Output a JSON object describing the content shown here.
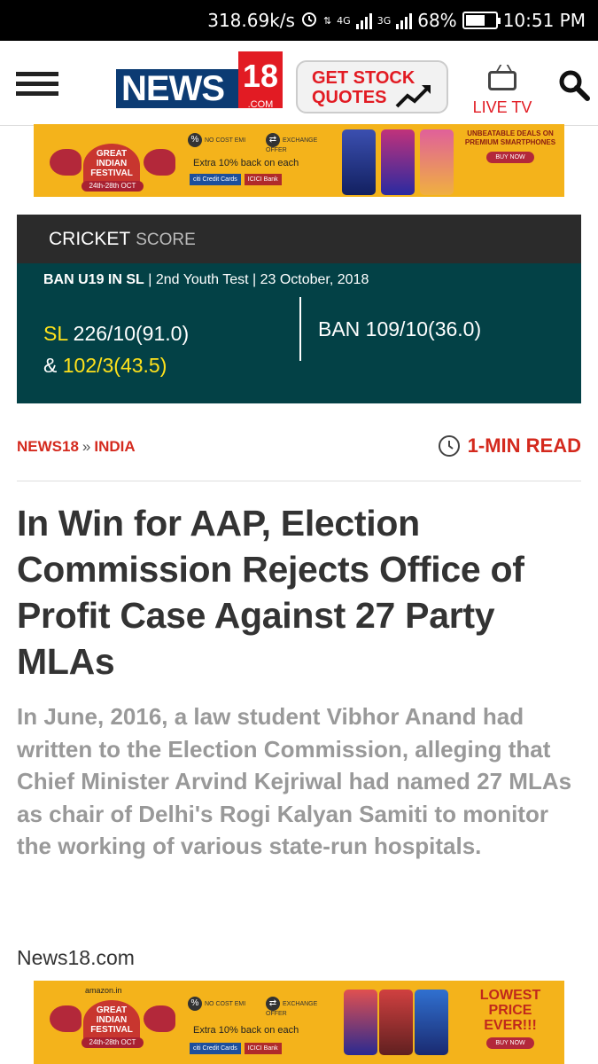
{
  "status_bar": {
    "speed": "318.69k/s",
    "net1": "4G",
    "net2": "3G",
    "battery": "68%",
    "battery_level": 0.68,
    "time": "10:51 PM"
  },
  "header": {
    "logo_main": "NEWS",
    "logo_number": "18",
    "logo_suffix": ".COM",
    "stock_button_line1": "GET STOCK",
    "stock_button_line2": "QUOTES",
    "live_tv_label": "LIVE TV",
    "colors": {
      "brand_red": "#e21b23",
      "brand_navy": "#0c3b73"
    }
  },
  "ad_top": {
    "festival": "GREAT INDIAN FESTIVAL",
    "festival_dates": "24th-28th OCT",
    "offer1": "NO COST EMI",
    "offer2": "EXCHANGE OFFER",
    "extra": "Extra 10% back on each",
    "card1": "citi Credit Cards",
    "card2": "ICICI Bank",
    "headline": "UNBEATABLE DEALS ON PREMIUM SMARTPHONES",
    "cta": "BUY NOW"
  },
  "cricket": {
    "title": "CRICKET",
    "subtitle": "SCORE",
    "match_teams": "BAN U19 IN SL",
    "match_detail": " | 2nd Youth Test | 23 October, 2018",
    "team1_name": "SL",
    "team1_score1": " 226/10(91.0)",
    "team1_amp": "& ",
    "team1_score2": "102/3(43.5)",
    "team2_name": "BAN",
    "team2_score": " 109/10(36.0)"
  },
  "breadcrumb": {
    "site": "NEWS18",
    "separator": "»",
    "section": "INDIA",
    "read_time": "1-MIN READ"
  },
  "article": {
    "headline": "In Win for AAP, Election Commission Rejects Office of Profit Case Against 27 Party MLAs",
    "summary": "In June, 2016, a law student Vibhor Anand had written to the Election Commission, alleging that Chief Minister Arvind Kejriwal had named 27 MLAs as chair of Delhi's Rogi Kalyan Samiti to monitor the working of various state-run hospitals.",
    "source": "News18.com"
  },
  "ad_bottom": {
    "brand": "amazon.in",
    "festival": "GREAT INDIAN FESTIVAL",
    "festival_dates": "24th-28th OCT",
    "offer1": "NO COST EMI",
    "offer2": "EXCHANGE OFFER",
    "extra": "Extra 10% back on each",
    "card1": "citi Credit Cards",
    "card2": "ICICI Bank",
    "headline_line1": "LOWEST",
    "headline_line2": "PRICE",
    "headline_line3": "EVER!!!",
    "cta": "BUY NOW"
  }
}
